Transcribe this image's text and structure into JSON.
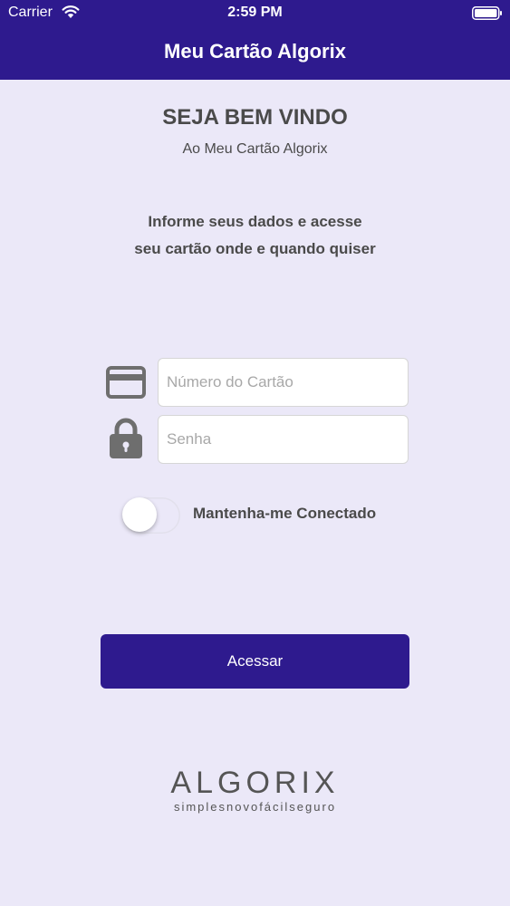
{
  "status_bar": {
    "carrier": "Carrier",
    "time": "2:59 PM"
  },
  "header": {
    "title": "Meu Cartão Algorix"
  },
  "welcome": {
    "title": "SEJA BEM VINDO",
    "subtitle": "Ao Meu Cartão Algorix"
  },
  "instructions": {
    "line1": "Informe seus dados e acesse",
    "line2": "seu cartão onde e quando quiser"
  },
  "form": {
    "card_number": {
      "value": "",
      "placeholder": "Número do Cartão",
      "icon": "credit-card-icon"
    },
    "password": {
      "value": "",
      "placeholder": "Senha",
      "icon": "lock-icon"
    },
    "remember": {
      "label": "Mantenha-me Conectado",
      "on": false
    },
    "submit_label": "Acessar"
  },
  "logo": {
    "name": "ALGORIX",
    "tagline": "simplesnovofácilseguro"
  },
  "colors": {
    "brand": "#2e1a8e",
    "background": "#ebe8f8",
    "text": "#4a4a4a",
    "icon": "#6e6e6e"
  }
}
